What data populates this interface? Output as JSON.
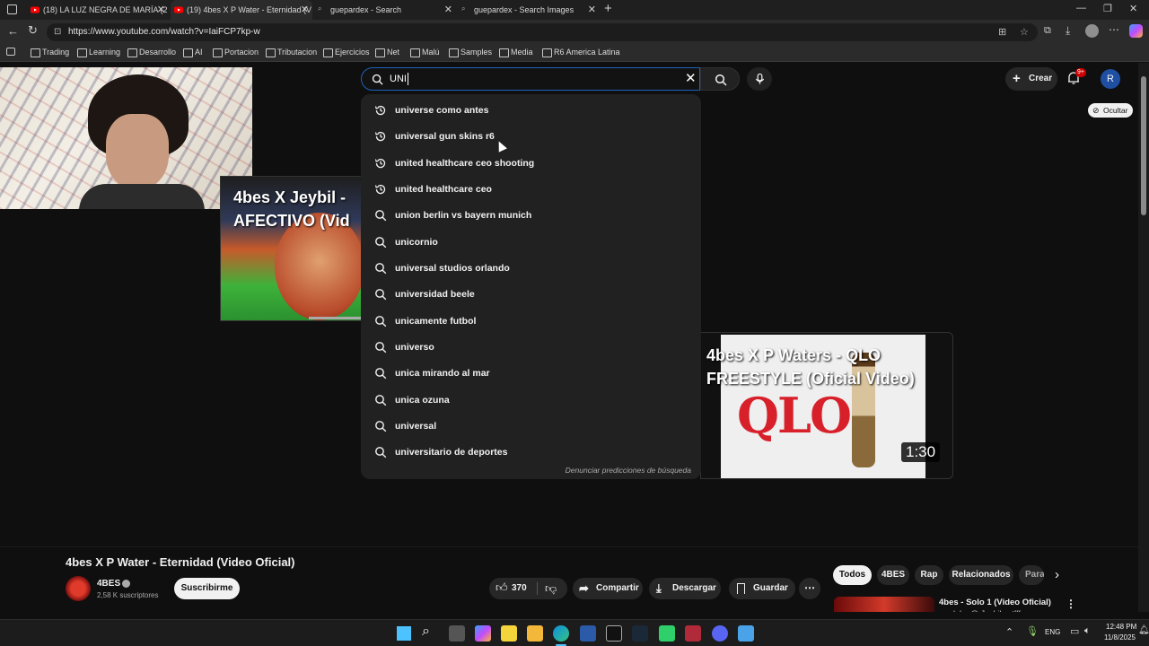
{
  "browser": {
    "tabs": [
      {
        "label": "(18) LA LUZ NEGRA DE MARÍA (2"
      },
      {
        "label": "(19) 4bes X P Water - Eternidad (V"
      },
      {
        "label": "guepardex - Search"
      },
      {
        "label": "guepardex - Search Images"
      }
    ],
    "url": "https://www.youtube.com/watch?v=IaiFCP7kp-w",
    "bookmarks": [
      "Trading",
      "Learning",
      "Desarrollo",
      "AI",
      "Portacion",
      "Tributacion",
      "Ejercicios",
      "Net",
      "Malú",
      "Samples",
      "Media",
      "R6 America Latina"
    ]
  },
  "youtube": {
    "search_value": "UNI",
    "create_label": "Crear",
    "notification_badge": "9+",
    "avatar_letter": "R",
    "hide_label": "Ocultar",
    "suggestions": [
      {
        "text": "universe como antes",
        "kind": "history"
      },
      {
        "text": "universal gun skins r6",
        "kind": "history"
      },
      {
        "text": "united healthcare ceo shooting",
        "kind": "history"
      },
      {
        "text": "united healthcare ceo",
        "kind": "history"
      },
      {
        "text": "union berlin vs bayern munich",
        "kind": "search"
      },
      {
        "text": "unicornio",
        "kind": "search"
      },
      {
        "text": "universal studios orlando",
        "kind": "search"
      },
      {
        "text": "universidad beele",
        "kind": "search"
      },
      {
        "text": "unicamente futbol",
        "kind": "search"
      },
      {
        "text": "universo",
        "kind": "search"
      },
      {
        "text": "unica mirando al mar",
        "kind": "search"
      },
      {
        "text": "unica ozuna",
        "kind": "search"
      },
      {
        "text": "universal",
        "kind": "search"
      },
      {
        "text": "universitario de deportes",
        "kind": "search"
      }
    ],
    "report_label": "Denunciar predicciones de búsqueda",
    "thumb1_title": "4bes X Jeybil - AFECTIVO (Vid",
    "thumb2_title": "4bes X P Waters - QLO FREESTYLE (Oficial Video)",
    "thumb2_duration": "1:30",
    "video_title": "4bes X P Water - Eternidad (Video Oficial)",
    "channel_name": "4BES",
    "subscribers": "2,58 K suscriptores",
    "subscribe_label": "Suscribirme",
    "likes": "370",
    "share_label": "Compartir",
    "download_label": "Descargar",
    "save_label": "Guardar",
    "chips": [
      "Todos",
      "4BES",
      "Rap",
      "Relacionados",
      "Para"
    ],
    "side_video_title": "4bes - Solo 1 (Video Oficial)",
    "side_video_sub": "prod. by @ Jeybil_wtfff"
  },
  "taskbar": {
    "lang": "ENG",
    "time": "12:48 PM",
    "date": "11/8/2025"
  },
  "colors": {
    "accent_blue": "#1c62b9",
    "youtube_red": "#ff0000",
    "page_bg": "#0f0f0f"
  }
}
